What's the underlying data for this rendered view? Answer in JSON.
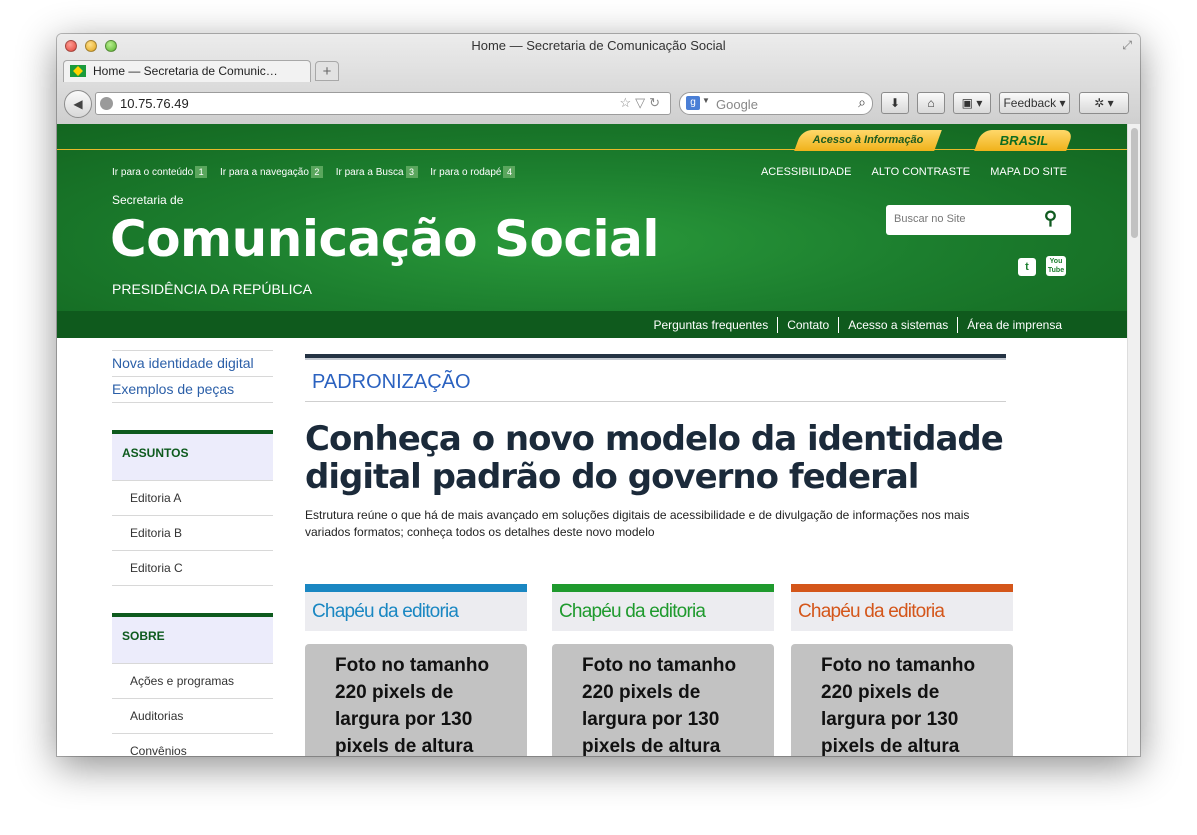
{
  "browser": {
    "window_title": "Home — Secretaria de Comunicação Social",
    "tab_title": "Home — Secretaria de Comunic…",
    "new_tab_label": "+",
    "url": "10.75.76.49",
    "search_placeholder": "Google",
    "feedback_label": "Feedback"
  },
  "gov_bar": {
    "acesso_label": "Acesso à Informação",
    "brasil_label": "BRASIL"
  },
  "skip_links": [
    {
      "label": "Ir para o conteúdo",
      "key": "1"
    },
    {
      "label": "Ir para a navegação",
      "key": "2"
    },
    {
      "label": "Ir para a Busca",
      "key": "3"
    },
    {
      "label": "Ir para o rodapé",
      "key": "4"
    }
  ],
  "util_links": [
    "ACESSIBILIDADE",
    "ALTO CONTRASTE",
    "MAPA DO SITE"
  ],
  "site": {
    "prefix": "Secretaria de",
    "title": "Comunicação Social",
    "subtitle": "PRESIDÊNCIA DA REPÚBLICA",
    "search_placeholder": "Buscar no Site"
  },
  "nav": [
    "Perguntas frequentes",
    "Contato",
    "Acesso a sistemas",
    "Área de imprensa"
  ],
  "sidebar": {
    "links": [
      "Nova identidade digital",
      "Exemplos de peças"
    ],
    "assuntos": {
      "title": "ASSUNTOS",
      "items": [
        "Editoria A",
        "Editoria B",
        "Editoria C"
      ]
    },
    "sobre": {
      "title": "SOBRE",
      "items": [
        "Ações e programas",
        "Auditorias",
        "Convênios"
      ]
    }
  },
  "main": {
    "section_title": "PADRONIZAÇÃO",
    "headline": "Conheça o novo modelo da identidade digital padrão do governo federal",
    "subtext": "Estrutura reúne o que há de mais avançado em soluções digitais de acessibilidade e de divulgação de informações nos mais variados formatos; conheça todos os detalhes deste novo modelo"
  },
  "cards": [
    {
      "chapeu": "Chapéu da editoria",
      "color": "#1a87c2",
      "photo": "Foto no tamanho 220 pixels de largura por 130 pixels de altura"
    },
    {
      "chapeu": "Chapéu da editoria",
      "color": "#1f9a2e",
      "photo": "Foto no tamanho 220 pixels de largura por 130 pixels de altura"
    },
    {
      "chapeu": "Chapéu da editoria",
      "color": "#d4561a",
      "photo": "Foto no tamanho 220 pixels de largura por 130 pixels de altura"
    }
  ],
  "colors": {
    "header_green": "#1c7e2e",
    "nav_green": "#0f5a1d",
    "gold": "#f0b21b",
    "link_blue": "#2b5fa8"
  }
}
